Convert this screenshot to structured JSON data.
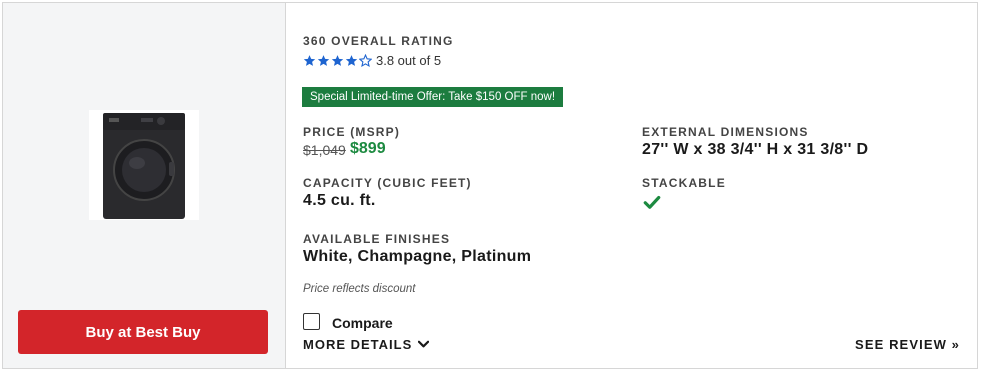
{
  "product": {
    "image_name": "front-load washer in black"
  },
  "buy_button": {
    "label": "Buy at Best Buy",
    "color": "#d3252a"
  },
  "rating": {
    "label": "360 OVERALL RATING",
    "value": 3.8,
    "text": "3.8 out of 5",
    "star_color": "#1e64d0"
  },
  "offer": {
    "text": "Special Limited-time Offer: Take $150 OFF now!",
    "color": "#1c7c3f"
  },
  "price": {
    "label": "PRICE (MSRP)",
    "msrp": "$1,049",
    "sale": "$899"
  },
  "dimensions": {
    "label": "EXTERNAL DIMENSIONS",
    "value": "27'' W x 38 3/4'' H x 31 3/8'' D"
  },
  "capacity": {
    "label": "CAPACITY (CUBIC FEET)",
    "value": "4.5 cu. ft."
  },
  "stackable": {
    "label": "STACKABLE",
    "icon": "check-icon",
    "check_color": "#1c8a40"
  },
  "finishes": {
    "label": "AVAILABLE FINISHES",
    "value": "White, Champagne, Platinum"
  },
  "note": "Price reflects discount",
  "compare": {
    "label": "Compare",
    "checked": false
  },
  "more_details": {
    "label": "MORE DETAILS"
  },
  "see_review": {
    "label": "SEE REVIEW »"
  }
}
